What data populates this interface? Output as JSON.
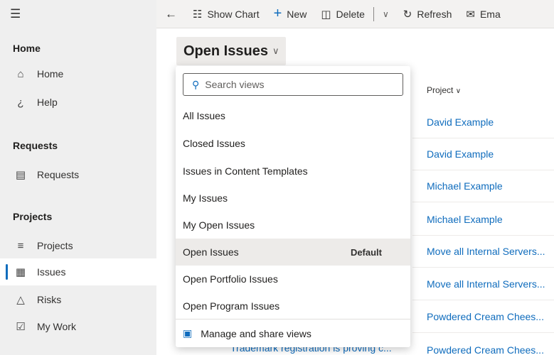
{
  "sidebar": {
    "menu_icon": "hamburger-icon",
    "groups": [
      {
        "title": "Home",
        "items": [
          {
            "label": "Home",
            "icon": "home-icon"
          },
          {
            "label": "Help",
            "icon": "help-icon"
          }
        ]
      },
      {
        "title": "Requests",
        "items": [
          {
            "label": "Requests",
            "icon": "requests-icon"
          }
        ]
      },
      {
        "title": "Projects",
        "items": [
          {
            "label": "Projects",
            "icon": "projects-icon"
          },
          {
            "label": "Issues",
            "icon": "issues-icon",
            "selected": true
          },
          {
            "label": "Risks",
            "icon": "risks-icon"
          },
          {
            "label": "My Work",
            "icon": "mywork-icon"
          }
        ]
      }
    ]
  },
  "commandbar": {
    "show_chart": "Show Chart",
    "new": "New",
    "delete": "Delete",
    "refresh": "Refresh",
    "email": "Ema"
  },
  "view": {
    "title": "Open Issues"
  },
  "grid": {
    "column_header": "Project",
    "rows": [
      "David Example",
      "David Example",
      "Michael Example",
      "Michael Example",
      "Move all Internal Servers...",
      "Move all Internal Servers...",
      "Powdered Cream Chees...",
      "Powdered Cream Chees..."
    ],
    "obscured_text": "Trademark registration is proving c..."
  },
  "view_selector": {
    "search_placeholder": "Search views",
    "items": [
      "All Issues",
      "Closed Issues",
      "Issues in Content Templates",
      "My Issues",
      "My Open Issues",
      "Open Issues",
      "Open Portfolio Issues",
      "Open Program Issues"
    ],
    "selected_index": 5,
    "default_badge": "Default",
    "footer": "Manage and share views"
  },
  "colors": {
    "accent": "#0f6cbd",
    "sidebar_bg": "#efefef",
    "selected_bg": "#edebe9"
  }
}
